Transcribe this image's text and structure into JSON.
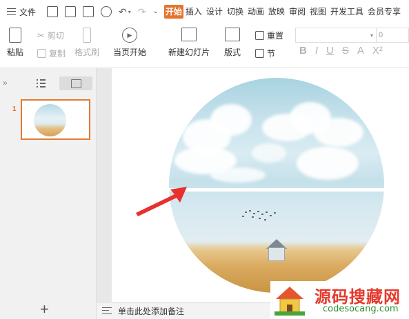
{
  "menubar": {
    "file_label": "文件",
    "tabs": [
      "开始",
      "插入",
      "设计",
      "切换",
      "动画",
      "放映",
      "审阅",
      "视图",
      "开发工具",
      "会员专享"
    ]
  },
  "ribbon": {
    "paste": "粘贴",
    "cut": "剪切",
    "copy": "复制",
    "format_painter": "格式刷",
    "play_from_current": "当页开始",
    "new_slide": "新建幻灯片",
    "layout": "版式",
    "reset": "重置",
    "section": "节",
    "font_size_value": "0"
  },
  "leftpanel": {
    "slide_number": "1"
  },
  "notes": {
    "placeholder": "单击此处添加备注"
  },
  "watermark": {
    "title": "源码搜藏网",
    "url": "codesocang.com"
  },
  "colors": {
    "accent": "#e7742e",
    "annotation_arrow": "#e8302c"
  }
}
